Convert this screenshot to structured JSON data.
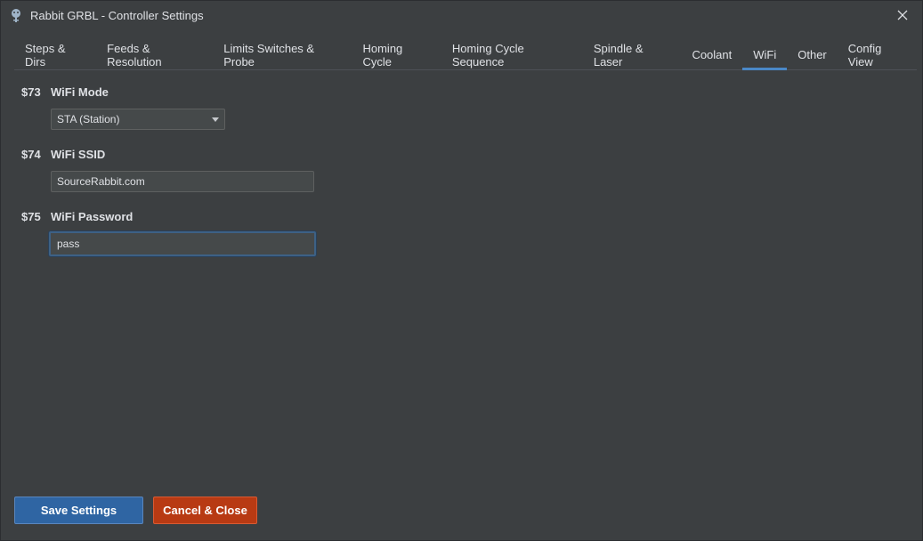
{
  "window": {
    "title": "Rabbit GRBL - Controller Settings"
  },
  "tabs": [
    {
      "label": "Steps & Dirs"
    },
    {
      "label": "Feeds & Resolution"
    },
    {
      "label": "Limits Switches & Probe"
    },
    {
      "label": "Homing Cycle"
    },
    {
      "label": "Homing Cycle Sequence"
    },
    {
      "label": "Spindle & Laser"
    },
    {
      "label": "Coolant"
    },
    {
      "label": "WiFi",
      "selected": true
    },
    {
      "label": "Other"
    },
    {
      "label": "Config View"
    }
  ],
  "fields": {
    "wifi_mode": {
      "code": "$73",
      "label": "WiFi Mode",
      "value": "STA (Station)"
    },
    "wifi_ssid": {
      "code": "$74",
      "label": "WiFi SSID",
      "value": "SourceRabbit.com"
    },
    "wifi_password": {
      "code": "$75",
      "label": "WiFi Password",
      "value": "pass"
    }
  },
  "buttons": {
    "save_label": "Save Settings",
    "cancel_label": "Cancel & Close"
  },
  "icons": {
    "app": "rabbit-app-icon",
    "close": "close-icon",
    "dropdown": "chevron-down-icon"
  },
  "colors": {
    "background": "#3c3f41",
    "tab_indicator": "#4a88c7",
    "save_button": "#2f65a3",
    "cancel_button": "#b83a13",
    "focus_border": "#3d6185"
  }
}
